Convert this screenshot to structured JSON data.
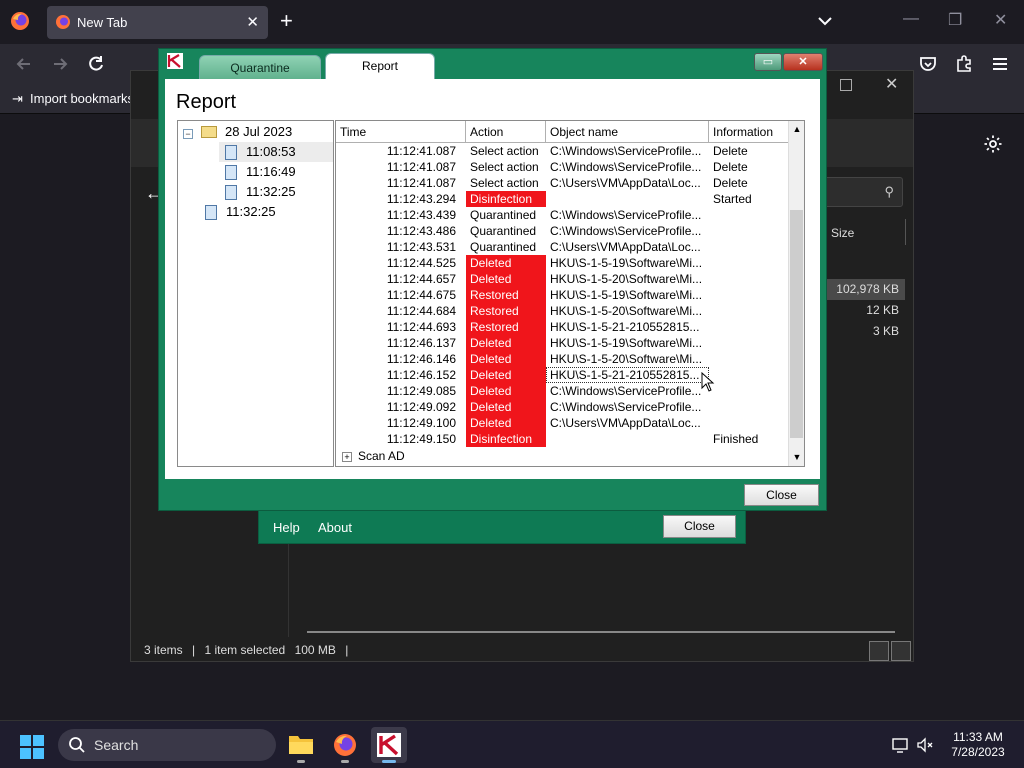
{
  "firefox": {
    "tab_title": "New Tab",
    "bookmark_item": "Import bookmarks..."
  },
  "explorer": {
    "column_size": "Size",
    "file_sizes": [
      "102,978 KB",
      "12 KB",
      "3 KB"
    ],
    "status_items": "3 items",
    "status_selected": "1 item selected",
    "status_size": "100 MB"
  },
  "kaspersky_main": {
    "help_link": "Help",
    "about_link": "About",
    "close_button": "Close"
  },
  "report_window": {
    "tab_quarantine": "Quarantine",
    "tab_report": "Report",
    "title": "Report",
    "close_button": "Close",
    "tree": {
      "date_node": "28 Jul 2023",
      "date_toggle": "−",
      "children": [
        "11:08:53",
        "11:16:49",
        "11:32:25"
      ],
      "root_item": "11:32:25"
    },
    "columns": [
      "Time",
      "Action",
      "Object name",
      "Information"
    ],
    "rows": [
      {
        "time": "11:12:41.087",
        "action": "Select action",
        "object": "C:\\Windows\\ServiceProfile...",
        "info": "Delete",
        "highlight": false
      },
      {
        "time": "11:12:41.087",
        "action": "Select action",
        "object": "C:\\Windows\\ServiceProfile...",
        "info": "Delete",
        "highlight": false
      },
      {
        "time": "11:12:41.087",
        "action": "Select action",
        "object": "C:\\Users\\VM\\AppData\\Loc...",
        "info": "Delete",
        "highlight": false
      },
      {
        "time": "11:12:43.294",
        "action": "Disinfection",
        "object": "",
        "info": "Started",
        "highlight": true
      },
      {
        "time": "11:12:43.439",
        "action": "Quarantined",
        "object": "C:\\Windows\\ServiceProfile...",
        "info": "",
        "highlight": false
      },
      {
        "time": "11:12:43.486",
        "action": "Quarantined",
        "object": "C:\\Windows\\ServiceProfile...",
        "info": "",
        "highlight": false
      },
      {
        "time": "11:12:43.531",
        "action": "Quarantined",
        "object": "C:\\Users\\VM\\AppData\\Loc...",
        "info": "",
        "highlight": false
      },
      {
        "time": "11:12:44.525",
        "action": "Deleted",
        "object": "HKU\\S-1-5-19\\Software\\Mi...",
        "info": "",
        "highlight": true
      },
      {
        "time": "11:12:44.657",
        "action": "Deleted",
        "object": "HKU\\S-1-5-20\\Software\\Mi...",
        "info": "",
        "highlight": true
      },
      {
        "time": "11:12:44.675",
        "action": "Restored",
        "object": "HKU\\S-1-5-19\\Software\\Mi...",
        "info": "",
        "highlight": true
      },
      {
        "time": "11:12:44.684",
        "action": "Restored",
        "object": "HKU\\S-1-5-20\\Software\\Mi...",
        "info": "",
        "highlight": true
      },
      {
        "time": "11:12:44.693",
        "action": "Restored",
        "object": "HKU\\S-1-5-21-210552815...",
        "info": "",
        "highlight": true
      },
      {
        "time": "11:12:46.137",
        "action": "Deleted",
        "object": "HKU\\S-1-5-19\\Software\\Mi...",
        "info": "",
        "highlight": true
      },
      {
        "time": "11:12:46.146",
        "action": "Deleted",
        "object": "HKU\\S-1-5-20\\Software\\Mi...",
        "info": "",
        "highlight": true
      },
      {
        "time": "11:12:46.152",
        "action": "Deleted",
        "object": "HKU\\S-1-5-21-210552815...",
        "info": "",
        "highlight": true,
        "focused": true
      },
      {
        "time": "11:12:49.085",
        "action": "Deleted",
        "object": "C:\\Windows\\ServiceProfile...",
        "info": "",
        "highlight": true
      },
      {
        "time": "11:12:49.092",
        "action": "Deleted",
        "object": "C:\\Windows\\ServiceProfile...",
        "info": "",
        "highlight": true
      },
      {
        "time": "11:12:49.100",
        "action": "Deleted",
        "object": "C:\\Users\\VM\\AppData\\Loc...",
        "info": "",
        "highlight": true
      },
      {
        "time": "11:12:49.150",
        "action": "Disinfection",
        "object": "",
        "info": "Finished",
        "highlight": true
      }
    ],
    "scan_group": "Scan AD",
    "scan_toggle": "+"
  },
  "taskbar": {
    "search_placeholder": "Search",
    "clock_time": "11:33 AM",
    "clock_date": "7/28/2023"
  },
  "colors": {
    "kaspersky_green": "#17855c",
    "alert_red": "#f0151b",
    "taskbar_bg": "#1f1d2e"
  }
}
